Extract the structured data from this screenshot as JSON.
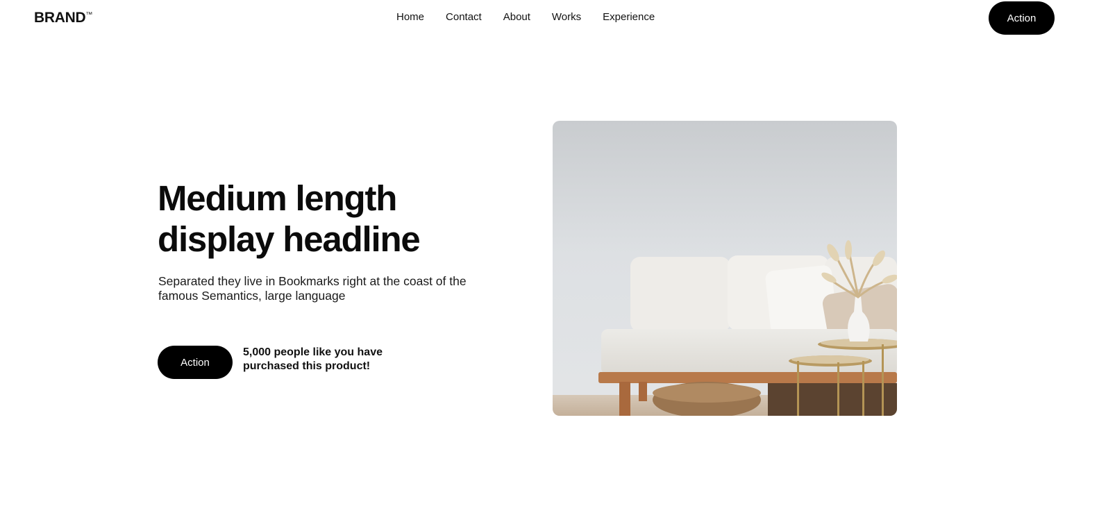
{
  "navbar": {
    "brand": "BRAND",
    "brand_mark": "™",
    "links": [
      "Home",
      "Contact",
      "About",
      "Works",
      "Experience"
    ],
    "action_label": "Action"
  },
  "hero": {
    "headline_line1": "Medium length",
    "headline_line2": "display headline",
    "subtext": "Separated they live in Bookmarks right at the coast of the famous Semantics, large language",
    "action_label": "Action",
    "social_proof_line1": "5,000 people like you have",
    "social_proof_line2": "purchased this product!",
    "image_subject": "living-room-sofa-photo"
  },
  "colors": {
    "background": "#ffffff",
    "button": "#000000",
    "button_text": "#ffffff",
    "text": "#111111"
  }
}
